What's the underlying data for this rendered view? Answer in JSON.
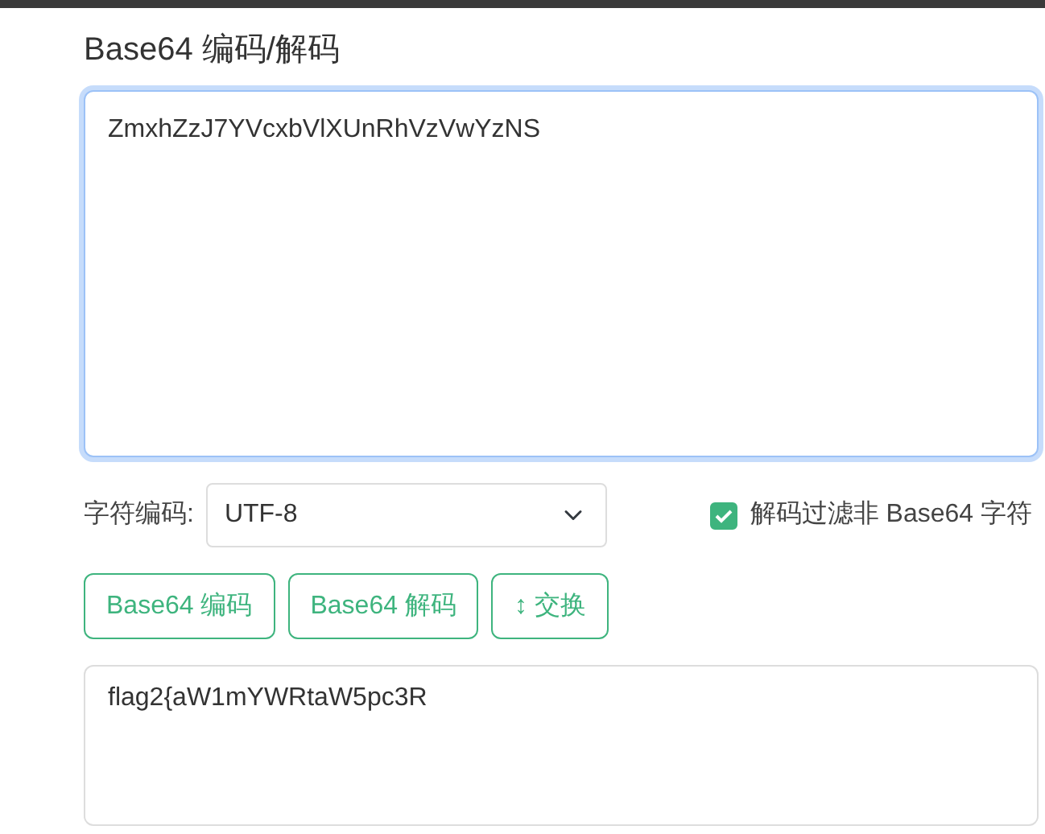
{
  "title": "Base64 编码/解码",
  "input": {
    "value": "ZmxhZzJ7YVcxbVlXUnRhVzVwYzNS",
    "focused": true
  },
  "charset": {
    "label": "字符编码:",
    "value": "UTF-8"
  },
  "filter": {
    "label": "解码过滤非 Base64 字符",
    "checked": true
  },
  "buttons": [
    "Base64 编码",
    "Base64 解码",
    "↕ 交换"
  ],
  "output": {
    "value": "flag2{aW1mYWRtaW5pc3R"
  }
}
